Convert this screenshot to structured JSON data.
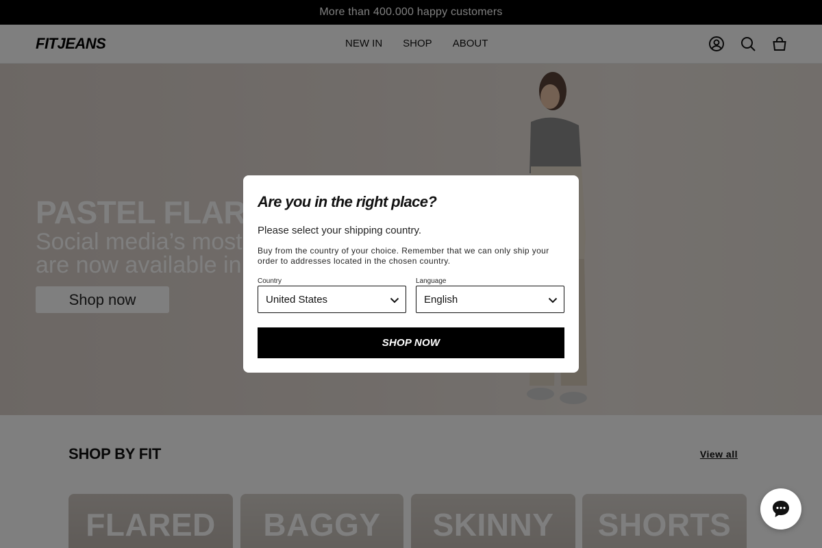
{
  "announcement": {
    "text": "More than 400.000 happy customers"
  },
  "header": {
    "logo": "FITJEANS",
    "nav": [
      "NEW IN",
      "SHOP",
      "ABOUT"
    ],
    "icons": [
      "account-icon",
      "search-icon",
      "cart-icon"
    ]
  },
  "hero": {
    "title": "PASTEL FLARE",
    "subtitle_line1": "Social media’s most w",
    "subtitle_line2": "are now available in ta",
    "button": "Shop now"
  },
  "shop_by_fit": {
    "title": "SHOP BY FIT",
    "view_all": "View all",
    "cards": [
      "FLARED",
      "BAGGY",
      "SKINNY",
      "SHORTS"
    ]
  },
  "modal": {
    "title": "Are you in the right place?",
    "lead": "Please select your shipping country.",
    "note": "Buy from the country of your choice. Remember that we can only ship your order to addresses located in the chosen country.",
    "country_label": "Country",
    "country_value": "United States",
    "language_label": "Language",
    "language_value": "English",
    "button": "SHOP NOW"
  },
  "colors": {
    "announcement_bg": "#000000",
    "button_bg": "#000000",
    "overlay": "rgba(0,0,0,0.5)"
  }
}
